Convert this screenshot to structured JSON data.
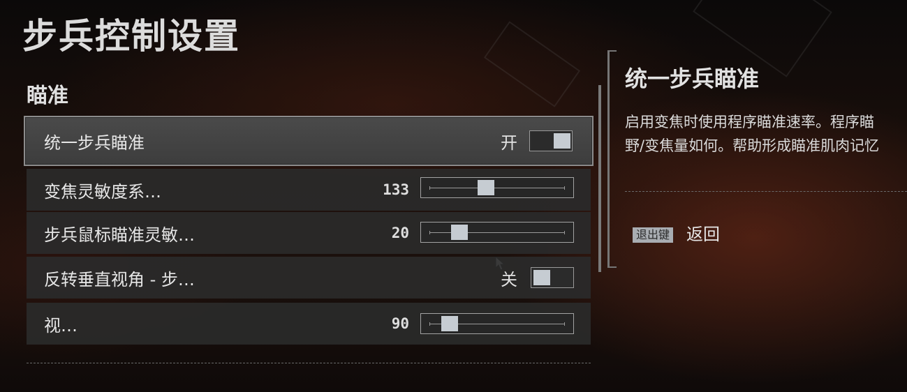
{
  "page": {
    "title": "步兵控制设置"
  },
  "section": {
    "title": "瞄准"
  },
  "settings": [
    {
      "label": "统一步兵瞄准",
      "type": "toggle",
      "state_label": "开",
      "on": true
    },
    {
      "label": "变焦灵敏度系…",
      "type": "slider",
      "value": "133",
      "level": 0.41
    },
    {
      "label": "步兵鼠标瞄准灵敏…",
      "type": "slider",
      "value": "20",
      "level": 0.19
    },
    {
      "label": "反转垂直视角 - 步…",
      "type": "toggle",
      "state_label": "关",
      "on": false
    },
    {
      "label": "视…",
      "type": "slider",
      "value": "90",
      "level": 0.11
    }
  ],
  "info_panel": {
    "title": "统一步兵瞄准",
    "description_lines": [
      "启用变焦时使用程序瞄准速率。程序瞄",
      "野/变焦量如何。帮助形成瞄准肌肉记忆"
    ],
    "back_key": "退出键",
    "back_label": "返回"
  }
}
